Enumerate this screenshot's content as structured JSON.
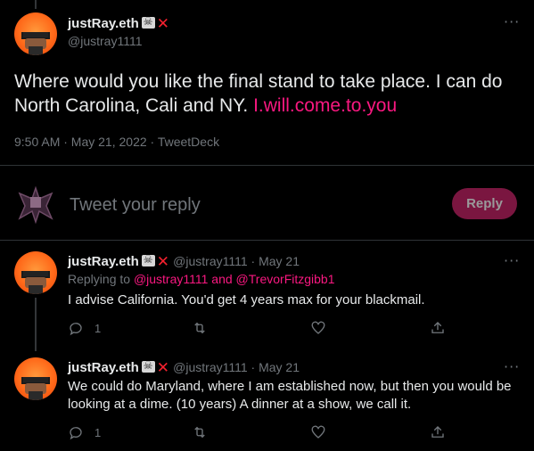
{
  "main_tweet": {
    "display_name": "justRay.eth",
    "handle": "@justray1111",
    "text": "Where would you like the final stand to take place. I can do North Carolina, Cali and NY.",
    "link": "I.will.come.to.you",
    "timestamp": "9:50 AM · May 21, 2022 · TweetDeck"
  },
  "composer": {
    "placeholder": "Tweet your reply",
    "reply_label": "Reply"
  },
  "replies": [
    {
      "display_name": "justRay.eth",
      "meta": "@justray1111 · May 21",
      "replying_prefix": "Replying to ",
      "replying_targets": "@justray1111 and @TrevorFitzgibb1",
      "text": "I advise California. You'd get 4 years max for your blackmail.",
      "reply_count": "1"
    },
    {
      "display_name": "justRay.eth",
      "meta": "@justray1111 · May 21",
      "text": "We could do Maryland, where I am established now, but then you would be looking at a dime. (10 years) A dinner at a show, we call it.",
      "reply_count": "1"
    }
  ],
  "icons": {
    "more": "more-icon",
    "reply": "reply-icon",
    "retweet": "retweet-icon",
    "like": "like-icon",
    "share": "share-icon",
    "skull_badge": "skull-crossbones-icon",
    "x_badge": "cross-mark-icon"
  },
  "colors": {
    "accent_pink": "#f91880",
    "reply_button_bg": "#7a1640",
    "muted": "#71767b",
    "background": "#000000"
  }
}
